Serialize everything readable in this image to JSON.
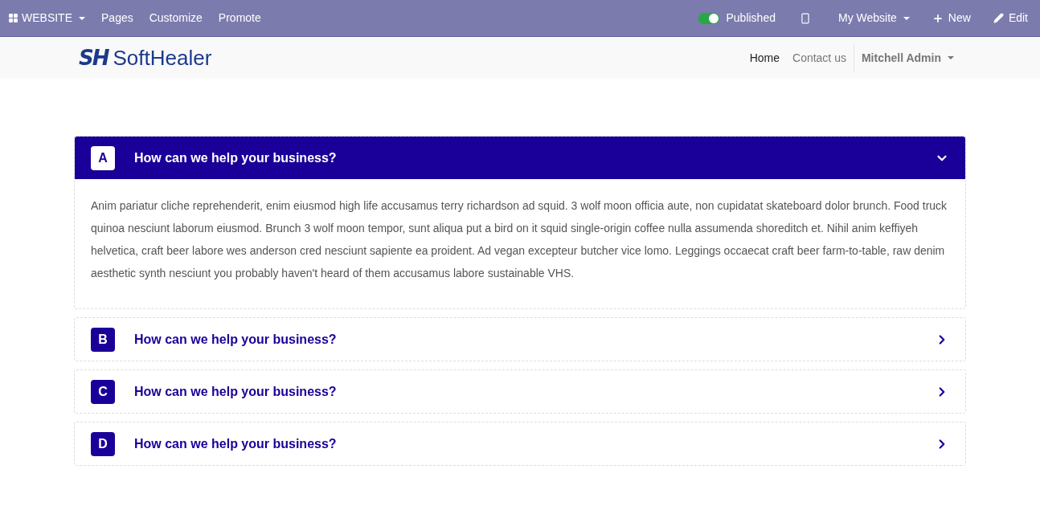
{
  "admin_bar": {
    "menu": [
      {
        "label": "WEBSITE",
        "kind": "apps"
      },
      {
        "label": "Pages",
        "kind": "plain"
      },
      {
        "label": "Customize",
        "kind": "plain"
      },
      {
        "label": "Promote",
        "kind": "plain"
      }
    ],
    "published": {
      "label": "Published",
      "on": true
    },
    "website": "My Website",
    "new": "New",
    "edit": "Edit"
  },
  "header": {
    "logo_mark": "SH",
    "logo_text": "SoftHealer",
    "nav": [
      {
        "label": "Home",
        "selected": true
      },
      {
        "label": "Contact us",
        "selected": false
      }
    ],
    "user": "Mitchell Admin"
  },
  "accordion": [
    {
      "letter": "A",
      "title": "How can we help your business?",
      "expanded": true,
      "body": "Anim pariatur cliche reprehenderit, enim eiusmod high life accusamus terry richardson ad squid. 3 wolf moon officia aute, non cupidatat skateboard dolor brunch. Food truck quinoa nesciunt laborum eiusmod. Brunch 3 wolf moon tempor, sunt aliqua put a bird on it squid single-origin coffee nulla assumenda shoreditch et. Nihil anim keffiyeh helvetica, craft beer labore wes anderson cred nesciunt sapiente ea proident. Ad vegan excepteur butcher vice lomo. Leggings occaecat craft beer farm-to-table, raw denim aesthetic synth nesciunt you probably haven't heard of them accusamus labore sustainable VHS."
    },
    {
      "letter": "B",
      "title": "How can we help your business?",
      "expanded": false
    },
    {
      "letter": "C",
      "title": "How can we help your business?",
      "expanded": false
    },
    {
      "letter": "D",
      "title": "How can we help your business?",
      "expanded": false
    }
  ]
}
